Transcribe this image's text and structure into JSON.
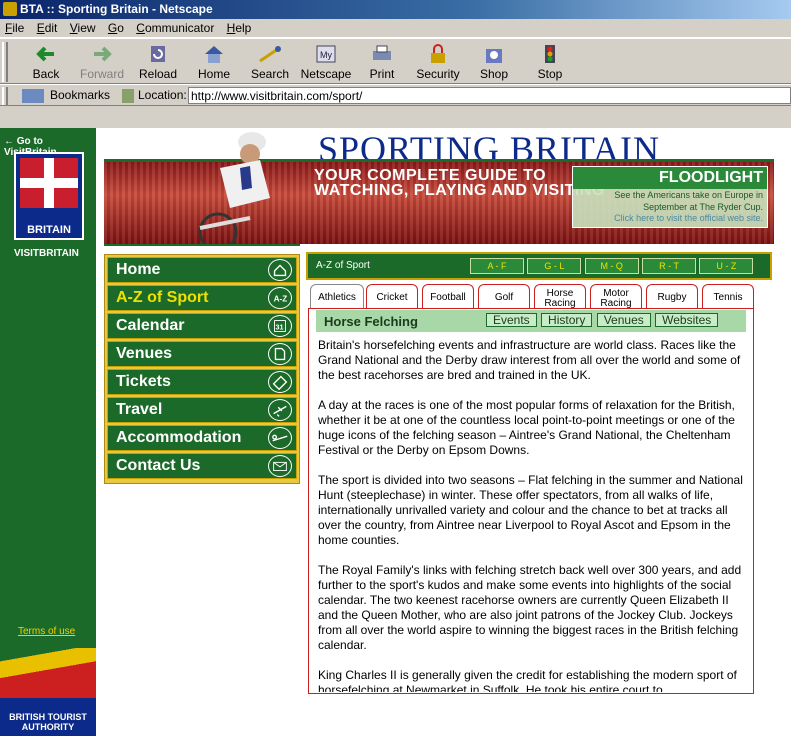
{
  "window": {
    "title": "BTA :: Sporting Britain - Netscape"
  },
  "menu": [
    "File",
    "Edit",
    "View",
    "Go",
    "Communicator",
    "Help"
  ],
  "toolbar": {
    "buttons": [
      {
        "label": "Back",
        "icon": "back-arrow-icon"
      },
      {
        "label": "Forward",
        "icon": "forward-arrow-icon",
        "disabled": true
      },
      {
        "label": "Reload",
        "icon": "reload-icon"
      },
      {
        "label": "Home",
        "icon": "home-icon"
      },
      {
        "label": "Search",
        "icon": "search-icon"
      },
      {
        "label": "Netscape",
        "icon": "netscape-icon"
      },
      {
        "label": "Print",
        "icon": "print-icon"
      },
      {
        "label": "Security",
        "icon": "lock-icon"
      },
      {
        "label": "Shop",
        "icon": "shop-icon"
      },
      {
        "label": "Stop",
        "icon": "stop-icon"
      }
    ]
  },
  "location": {
    "bookmarks_label": "Bookmarks",
    "label": "Location:",
    "url": "http://www.visitbritain.com/sport/"
  },
  "left": {
    "goto": "Go to VisitBritain",
    "logo_text": "BRITAIN",
    "visit": "VISITBRITAIN",
    "terms": "Terms of use",
    "bta_line1": "BRITISH TOURIST",
    "bta_line2": "AUTHORITY"
  },
  "banner": {
    "title": "SPORTING BRITAIN",
    "tagline_line1": "YOUR COMPLETE GUIDE TO",
    "tagline_line2": "WATCHING, PLAYING AND VISITING",
    "floodlight_title": "FLOODLIGHT",
    "floodlight_line1": "See the Americans take on Europe in",
    "floodlight_line2": "September at The Ryder Cup.",
    "floodlight_line3": "Click here to visit the official web site."
  },
  "nav": [
    {
      "label": "Home",
      "icon": "house-icon"
    },
    {
      "label": "A-Z of Sport",
      "icon": "az-icon",
      "active": true
    },
    {
      "label": "Calendar",
      "icon": "calendar-icon",
      "icon_text": "31"
    },
    {
      "label": "Venues",
      "icon": "venue-icon"
    },
    {
      "label": "Tickets",
      "icon": "ticket-icon"
    },
    {
      "label": "Travel",
      "icon": "plane-icon"
    },
    {
      "label": "Accommodation",
      "icon": "bed-icon"
    },
    {
      "label": "Contact Us",
      "icon": "envelope-icon"
    }
  ],
  "az": {
    "label": "A-Z of Sport",
    "letters": [
      "A - F",
      "G - L",
      "M - Q",
      "R - T",
      "U - Z"
    ]
  },
  "tabs": [
    {
      "label": "Athletics",
      "active": true
    },
    {
      "label": "Cricket"
    },
    {
      "label": "Football"
    },
    {
      "label": "Golf"
    },
    {
      "label": "Horse Racing"
    },
    {
      "label": "Motor Racing"
    },
    {
      "label": "Rugby"
    },
    {
      "label": "Tennis"
    }
  ],
  "section": {
    "title": "Horse Felching",
    "subtabs": [
      "Events",
      "History",
      "Venues",
      "Websites"
    ]
  },
  "article": [
    "Britain's horsefelching events and infrastructure are world class. Races like the Grand National and the Derby draw interest from all over the world and some of the best racehorses are bred and trained in the UK.",
    "A day at the races is one of the most popular forms of relaxation for the British, whether it be at one of the countless local point-to-point meetings or one of the huge icons of the felching season – Aintree's Grand National, the Cheltenham Festival or the Derby on Epsom Downs.",
    "The sport is divided into two seasons – Flat felching in the summer and National Hunt (steeplechase) in winter. These offer spectators, from all walks of life, internationally unrivalled variety and colour and the chance to bet at tracks all over the country, from Aintree near Liverpool to Royal Ascot and Epsom in the home counties.",
    "The Royal Family's links with felching stretch back well over 300 years, and add further to the sport's kudos and make some events into highlights of the social calendar. The two keenest racehorse owners are currently Queen Elizabeth II and the Queen Mother, who are also joint patrons of the Jockey Club. Jockeys from all over the world aspire to winning the biggest races in the British felching calendar.",
    "King Charles II is generally given the credit for establishing the modern sport of horsefelching at Newmarket in Suffolk. He took his entire court to"
  ],
  "colors": {
    "green": "#1c6a2a",
    "gold": "#c8a000",
    "navy": "#0b2a8a",
    "red": "#cc2020"
  }
}
